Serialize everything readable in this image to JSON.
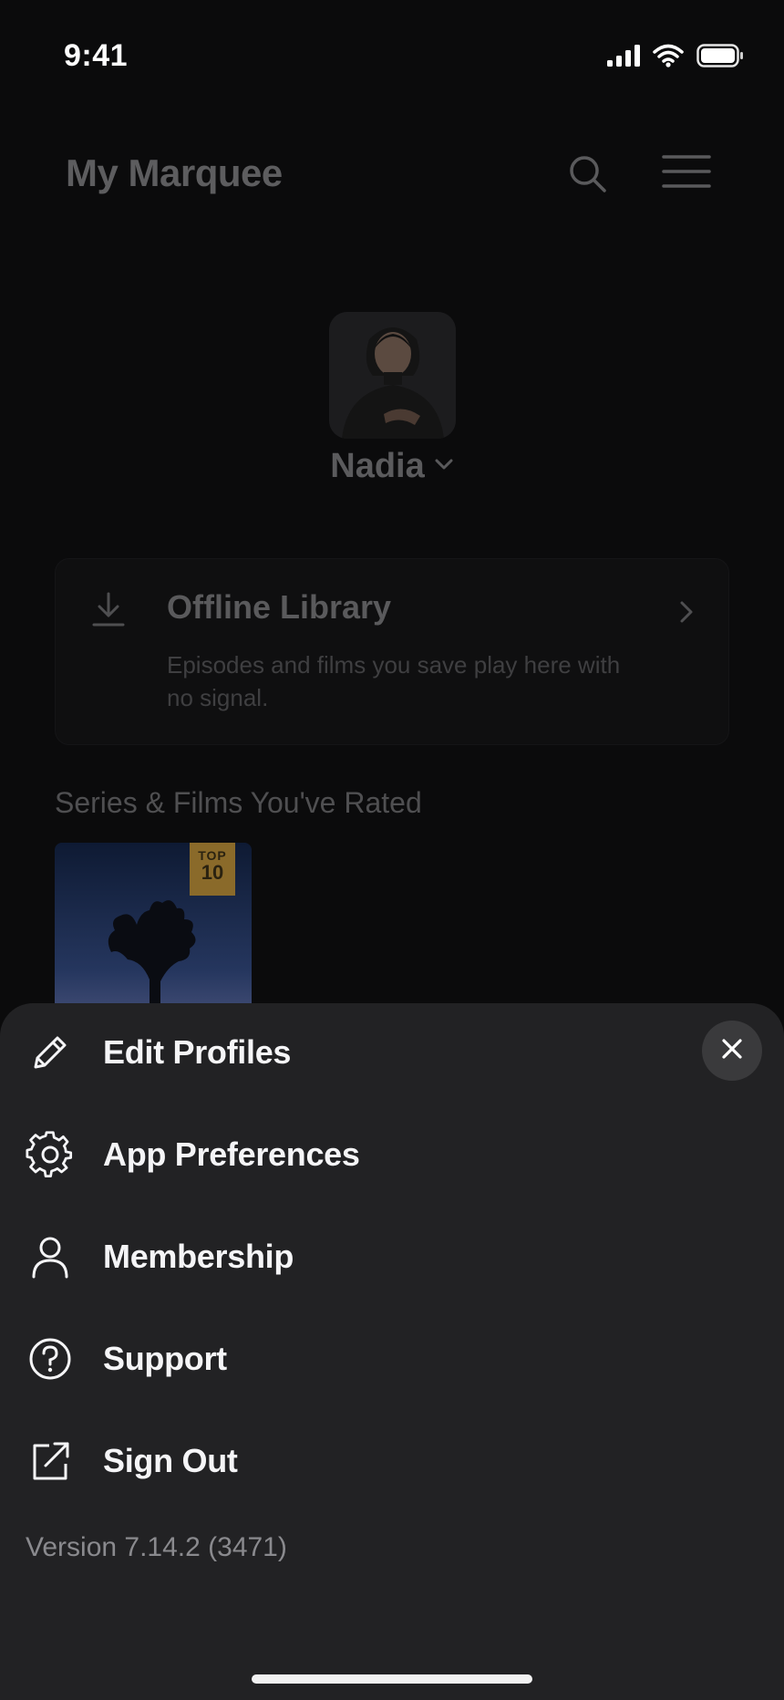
{
  "status_bar": {
    "time": "9:41",
    "signal_icon": "cellular-signal-icon",
    "wifi_icon": "wifi-icon",
    "battery_icon": "battery-icon"
  },
  "header": {
    "title": "My Marquee",
    "search_icon": "search-icon",
    "menu_icon": "hamburger-menu-icon"
  },
  "profile": {
    "name": "Nadia",
    "chevron_icon": "chevron-down-icon"
  },
  "offline_library": {
    "title": "Offline Library",
    "description": "Episodes and films you save play here with no signal.",
    "icon": "download-icon",
    "chevron_icon": "chevron-right-icon"
  },
  "rated_section": {
    "heading": "Series & Films You've Rated",
    "posters": [
      {
        "badge_top": "TOP",
        "badge_num": "10"
      }
    ]
  },
  "sheet": {
    "close_icon": "close-icon",
    "items": [
      {
        "label": "Edit Profiles",
        "icon": "pencil-icon"
      },
      {
        "label": "App Preferences",
        "icon": "gear-icon"
      },
      {
        "label": "Membership",
        "icon": "person-icon"
      },
      {
        "label": "Support",
        "icon": "question-circle-icon"
      },
      {
        "label": "Sign Out",
        "icon": "external-link-icon"
      }
    ],
    "version": "Version 7.14.2 (3471)"
  },
  "colors": {
    "background": "#0b0b0c",
    "sheet": "#222224",
    "close_button": "#3a3a3c",
    "badge": "#8a6a2a"
  }
}
